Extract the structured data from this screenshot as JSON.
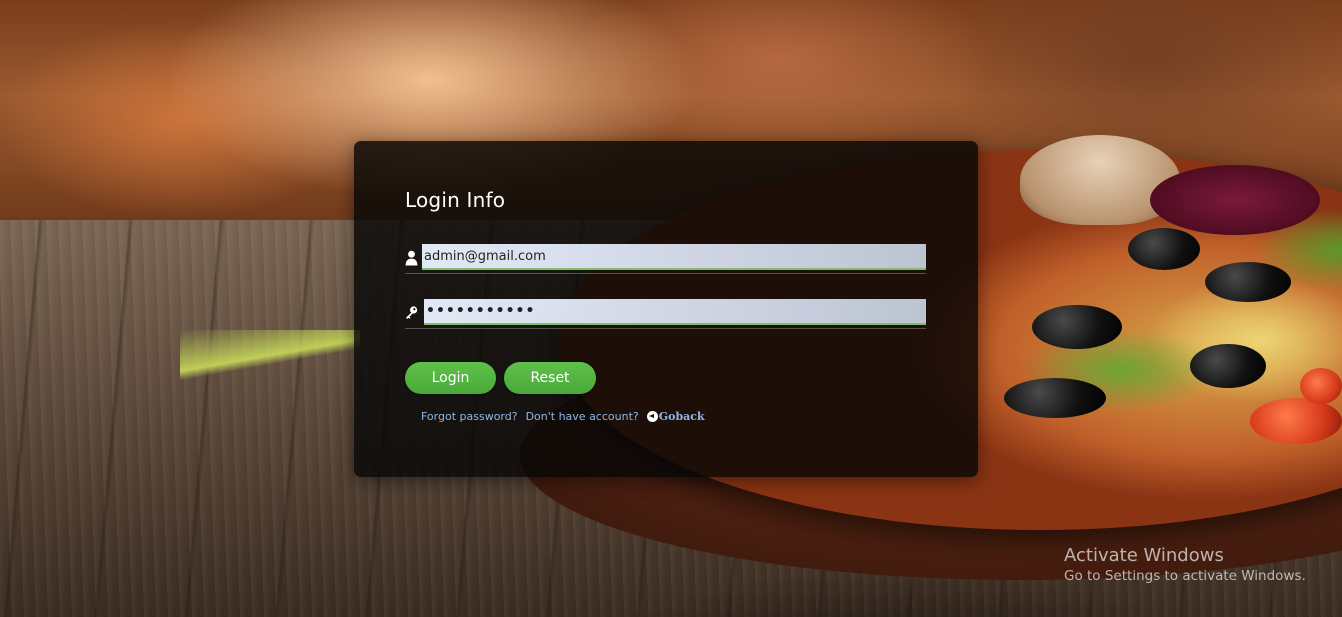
{
  "login": {
    "title": "Login Info",
    "email_value": "admin@gmail.com",
    "password_value": "•••••••••••",
    "login_button": "Login",
    "reset_button": "Reset",
    "forgot_link": "Forgot password?",
    "signup_link": "Don't have account?",
    "goback_link": "Goback"
  },
  "icons": {
    "email": "user-icon",
    "password": "key-icon",
    "goback": "arrow-left-circle-icon"
  },
  "colors": {
    "accent": "#5fc14a",
    "link": "#8fb6e8",
    "panel": "#060606"
  },
  "watermark": {
    "title": "Activate Windows",
    "subtitle": "Go to Settings to activate Windows."
  }
}
